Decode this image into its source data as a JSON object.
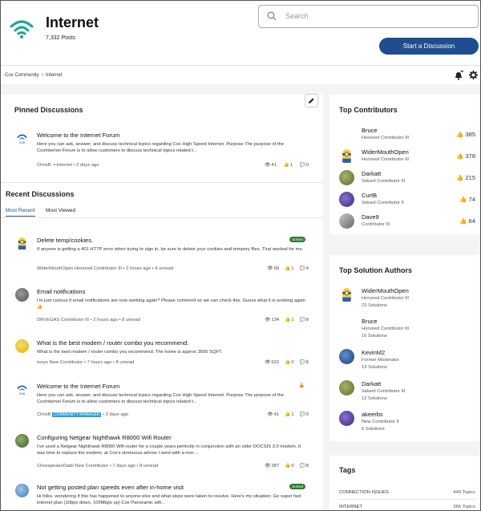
{
  "header": {
    "title": "Internet",
    "posts": "7,332 Posts",
    "search_placeholder": "Search",
    "start_button": "Start a Discussion"
  },
  "breadcrumb": {
    "root": "Cox Community",
    "current": "Internet"
  },
  "pinned": {
    "heading": "Pinned Discussions",
    "post": {
      "title": "Welcome to the Internet Forum",
      "excerpt": "Here you can ask, answer, and discuss technical topics regarding Cox High Speed Internet. Purpose The purpose of the CoxInternet Forum is to allow customers to discuss technical topics related t...",
      "author": "ChrisB",
      "meta": "Internet • 2 days ago",
      "views": "41",
      "kudos": "1",
      "replies": "0"
    }
  },
  "recent": {
    "heading": "Recent Discussions",
    "tabs": [
      "Most Recent",
      "Most Viewed"
    ],
    "posts": [
      {
        "title": "Delete temp/cookies.",
        "excerpt": "If anyone is getting a 401 HTTP error when trying to sign in, be sure to delete your cookies and tempory files. That worked for me.",
        "author": "WiderMouthOpen",
        "role": "Honored Contributor III",
        "meta": "• 2 hours ago • 4 unread",
        "views": "66",
        "kudos": "1",
        "replies": "4",
        "badge": "Solved"
      },
      {
        "title": "Email notifications",
        "excerpt": "I'm just curious if email notifications are now working again? Please comment so we can check this. Guess what it is working again 👍",
        "author": "DRVEGAS",
        "role": "Contributor III",
        "meta": "• 2 hours ago • 8 unread",
        "views": "134",
        "kudos": "1",
        "replies": "8",
        "badge": ""
      },
      {
        "title": "What is the best modem / router combo you recommend.",
        "excerpt": "What is the best modem / router combo you recommend. The home is approx 3500 SQFT.",
        "author": "tonys",
        "role": "New Contributor",
        "meta": "• 7 hours ago • 8 unread",
        "views": "522",
        "kudos": "0",
        "replies": "8",
        "badge": ""
      },
      {
        "title": "Welcome to the Internet Forum",
        "excerpt": "Here you can ask, answer, and discuss technical topics regarding Cox High Speed Internet. Purpose The purpose of the CoxInternet Forum is to allow customers to discuss technical topics related t...",
        "author": "ChrisB",
        "role": "COMMUNITY MANAGER",
        "meta": "• 2 days ago",
        "views": "41",
        "kudos": "1",
        "replies": "0",
        "badge": ""
      },
      {
        "title": "Configuring Netgear Nighthawk R8000 Wifi Router",
        "excerpt": "I've used a Netgear Nighthawk R8000 Wifi router for a couple years perfectly in conjunction with an older DOCSIS 3.0 modem. It was time to replace the modem; at Cox's strenuous advise I went with a non-...",
        "author": "ChesapeakeDiabl",
        "role": "New Contributor",
        "meta": "• 7 days ago • 8 unread",
        "views": "287",
        "kudos": "0",
        "replies": "8",
        "badge": ""
      },
      {
        "title": "Not getting posted plan speeds even after in-home visit",
        "excerpt": "Hi folks, wondering if this has happened to anyone else and what steps were taken to resolve. Here's my situation: Go super fast internet plan (10bps down, 100Mbps up) Cox Panoramic wifi...",
        "author": "",
        "role": "",
        "meta": "",
        "views": "",
        "kudos": "",
        "replies": "",
        "badge": "Solved"
      }
    ]
  },
  "top_contributors": {
    "heading": "Top Contributors",
    "items": [
      {
        "name": "Bruce",
        "rank": "Honored Contributor III",
        "kudos": "385"
      },
      {
        "name": "WiderMouthOpen",
        "rank": "Honored Contributor III",
        "kudos": "378"
      },
      {
        "name": "Darkatt",
        "rank": "Valued Contributor III",
        "kudos": "215"
      },
      {
        "name": "CurtB",
        "rank": "Valued Contributor II",
        "kudos": "74"
      },
      {
        "name": "Dave9",
        "rank": "Contributor III",
        "kudos": "64"
      }
    ]
  },
  "top_solution_authors": {
    "heading": "Top Solution Authors",
    "items": [
      {
        "name": "WiderMouthOpen",
        "rank": "Honored Contributor III",
        "solutions": "23 Solutions"
      },
      {
        "name": "Bruce",
        "rank": "Honored Contributor III",
        "solutions": "16 Solutions"
      },
      {
        "name": "KevinM2",
        "rank": "Former Moderator",
        "solutions": "13 Solutions"
      },
      {
        "name": "Darkatt",
        "rank": "Valued Contributor III",
        "solutions": "12 Solutions"
      },
      {
        "name": "akeerbs",
        "rank": "New Contributor II",
        "solutions": "6 Solutions"
      }
    ]
  },
  "tags": {
    "heading": "Tags",
    "items": [
      {
        "name": "CONNECTION ISSUES",
        "count": "449 Topics"
      },
      {
        "name": "INTERNET",
        "count": "366 Topics"
      }
    ]
  },
  "colors": {
    "accent": "#1f4d8f",
    "solved": "#2e7d32",
    "wifi": "#1aa88f"
  }
}
